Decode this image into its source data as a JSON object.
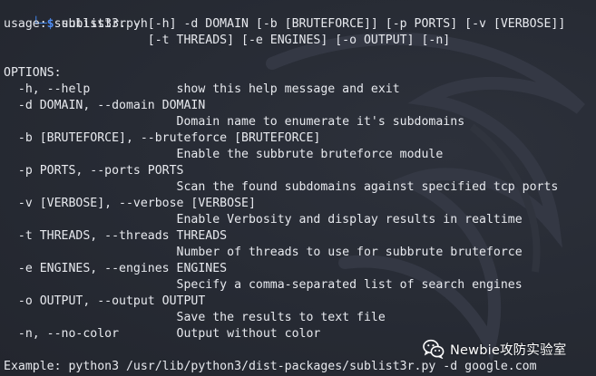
{
  "prompt": {
    "frame": "└─",
    "symbol": "$",
    "command": "sublist3r",
    "argument": "-h"
  },
  "output_lines": [
    "usage: sublist3r.py [-h] -d DOMAIN [-b [BRUTEFORCE]] [-p PORTS] [-v [VERBOSE]]",
    "                    [-t THREADS] [-e ENGINES] [-o OUTPUT] [-n]",
    "",
    "OPTIONS:",
    "  -h, --help            show this help message and exit",
    "  -d DOMAIN, --domain DOMAIN",
    "                        Domain name to enumerate it's subdomains",
    "  -b [BRUTEFORCE], --bruteforce [BRUTEFORCE]",
    "                        Enable the subbrute bruteforce module",
    "  -p PORTS, --ports PORTS",
    "                        Scan the found subdomains against specified tcp ports",
    "  -v [VERBOSE], --verbose [VERBOSE]",
    "                        Enable Verbosity and display results in realtime",
    "  -t THREADS, --threads THREADS",
    "                        Number of threads to use for subbrute bruteforce",
    "  -e ENGINES, --engines ENGINES",
    "                        Specify a comma-separated list of search engines",
    "  -o OUTPUT, --output OUTPUT",
    "                        Save the results to text file",
    "  -n, --no-color        Output without color",
    "",
    "Example: python3 /usr/lib/python3/dist-packages/sublist3r.py -d google.com"
  ],
  "watermark": {
    "icon": "wechat-icon",
    "text": "Newbie攻防实验室"
  },
  "colors": {
    "background": "#262a33",
    "text": "#e7e9ee",
    "prompt_accent": "#3f7fe0"
  }
}
